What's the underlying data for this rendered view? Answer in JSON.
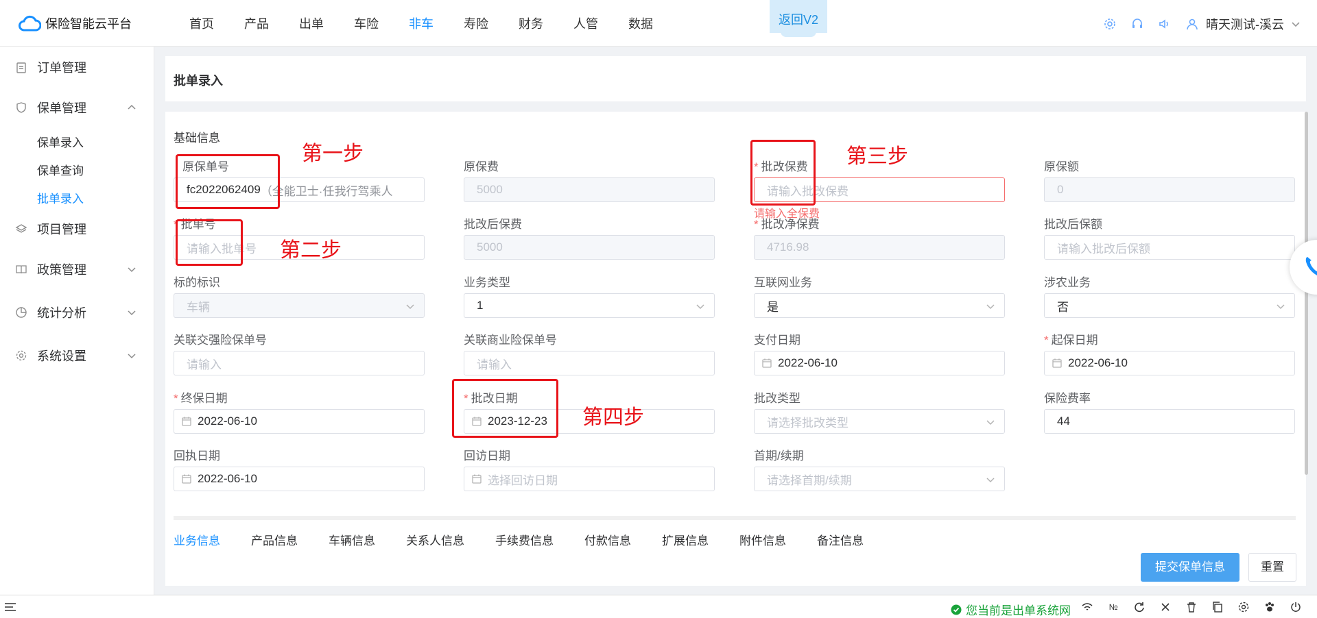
{
  "app": {
    "title": "保险智能云平台"
  },
  "nav": {
    "items": [
      "首页",
      "产品",
      "出单",
      "车险",
      "非车",
      "寿险",
      "财务",
      "人管",
      "数据"
    ],
    "active_index": 4,
    "v2_button": "返回V2"
  },
  "user": {
    "name": "晴天测试-溪云"
  },
  "colors": {
    "primary": "#1890ff",
    "required": "#f56c6c",
    "annotation": "#e8141a",
    "status_ok": "#19a33a"
  },
  "sidebar": {
    "order": "订单管理",
    "policy": "保单管理",
    "policy_sub": [
      "保单录入",
      "保单查询",
      "批单录入"
    ],
    "project": "项目管理",
    "strategy": "政策管理",
    "stats": "统计分析",
    "settings": "系统设置"
  },
  "page": {
    "title": "批单录入",
    "section": "基础信息"
  },
  "form": {
    "orig_policy_no": {
      "label": "原保单号",
      "value": "fc2022062409",
      "suffix": "（全能卫士·任我行驾乘人"
    },
    "orig_premium": {
      "label": "原保费",
      "value": "5000"
    },
    "amend_premium": {
      "label": "批改保费",
      "placeholder": "请输入批改保费",
      "error": "请输入全保费"
    },
    "orig_amount": {
      "label": "原保额",
      "value": "0"
    },
    "endorse_no": {
      "label": "批单号",
      "placeholder": "请输入批单号"
    },
    "premium_after": {
      "label": "批改后保费",
      "value": "5000"
    },
    "net_premium": {
      "label": "批改净保费",
      "value": "4716.98"
    },
    "amount_after": {
      "label": "批改后保额",
      "placeholder": "请输入批改后保额"
    },
    "subject": {
      "label": "标的标识",
      "value": "车辆"
    },
    "biz_type": {
      "label": "业务类型",
      "value": "1"
    },
    "internet": {
      "label": "互联网业务",
      "value": "是"
    },
    "agri": {
      "label": "涉农业务",
      "value": "否"
    },
    "ci_no": {
      "label": "关联交强险保单号",
      "placeholder": "请输入"
    },
    "bi_no": {
      "label": "关联商业险保单号",
      "placeholder": "请输入"
    },
    "pay_date": {
      "label": "支付日期",
      "value": "2022-06-10"
    },
    "start_date": {
      "label": "起保日期",
      "value": "2022-06-10"
    },
    "end_date": {
      "label": "终保日期",
      "value": "2022-06-10"
    },
    "amend_date": {
      "label": "批改日期",
      "value": "2023-12-23"
    },
    "amend_type": {
      "label": "批改类型",
      "placeholder": "请选择批改类型"
    },
    "rate": {
      "label": "保险费率",
      "value": "44"
    },
    "receipt_date": {
      "label": "回执日期",
      "value": "2022-06-10"
    },
    "visit_date": {
      "label": "回访日期",
      "placeholder": "选择回访日期"
    },
    "period": {
      "label": "首期/续期",
      "placeholder": "请选择首期/续期"
    }
  },
  "annotations": {
    "step1": "第一步",
    "step2": "第二步",
    "step3": "第三步",
    "step4": "第四步"
  },
  "tabs": [
    "业务信息",
    "产品信息",
    "车辆信息",
    "关系人信息",
    "手续费信息",
    "付款信息",
    "扩展信息",
    "附件信息",
    "备注信息"
  ],
  "buttons": {
    "submit": "提交保单信息",
    "reset": "重置"
  },
  "status": {
    "text": "您当前是出单系统网",
    "no_symbol": "№"
  }
}
